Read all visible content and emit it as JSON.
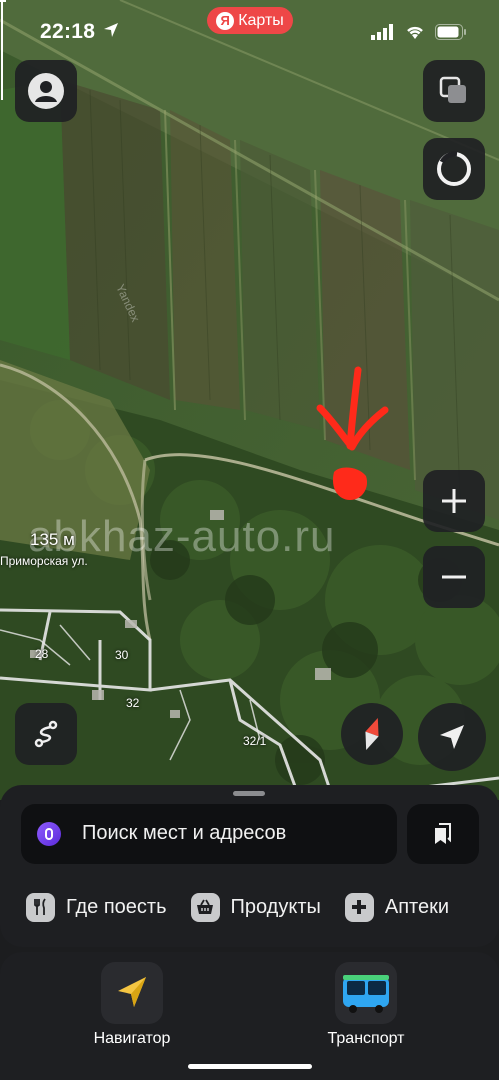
{
  "status_bar": {
    "time": "22:18",
    "app_pill": "Карты",
    "app_pill_logo": "Я"
  },
  "map": {
    "scale_label": "135 м",
    "street_label": "Приморская ул.",
    "house_numbers": [
      "28",
      "30",
      "32",
      "32/1"
    ],
    "watermark": "abkhaz-auto.ru",
    "provider_mark": "Yandex"
  },
  "search": {
    "placeholder": "Поиск мест и адресов"
  },
  "categories": [
    {
      "label": "Где поесть",
      "icon": "fork-knife-icon"
    },
    {
      "label": "Продукты",
      "icon": "basket-icon"
    },
    {
      "label": "Аптеки",
      "icon": "plus-cross-icon"
    }
  ],
  "dock": {
    "apps": [
      {
        "label": "Навигатор",
        "icon": "navigator-arrow-icon"
      },
      {
        "label": "Транспорт",
        "icon": "bus-icon"
      }
    ]
  },
  "colors": {
    "pill": "#ee4747",
    "button_bg": "#202124",
    "sheet_bg": "#1e1f22",
    "marker": "#ff2a1a",
    "alice": "#7c4dff"
  }
}
